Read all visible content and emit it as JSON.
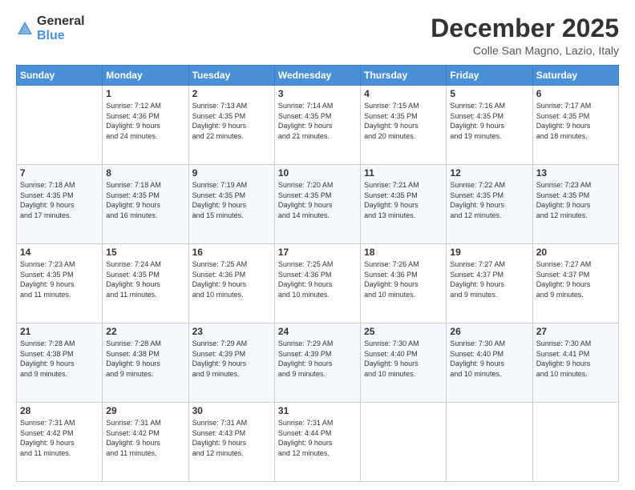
{
  "header": {
    "logo_general": "General",
    "logo_blue": "Blue",
    "month_title": "December 2025",
    "location": "Colle San Magno, Lazio, Italy"
  },
  "calendar": {
    "days_of_week": [
      "Sunday",
      "Monday",
      "Tuesday",
      "Wednesday",
      "Thursday",
      "Friday",
      "Saturday"
    ],
    "weeks": [
      [
        {
          "day": "",
          "info": ""
        },
        {
          "day": "1",
          "info": "Sunrise: 7:12 AM\nSunset: 4:36 PM\nDaylight: 9 hours\nand 24 minutes."
        },
        {
          "day": "2",
          "info": "Sunrise: 7:13 AM\nSunset: 4:35 PM\nDaylight: 9 hours\nand 22 minutes."
        },
        {
          "day": "3",
          "info": "Sunrise: 7:14 AM\nSunset: 4:35 PM\nDaylight: 9 hours\nand 21 minutes."
        },
        {
          "day": "4",
          "info": "Sunrise: 7:15 AM\nSunset: 4:35 PM\nDaylight: 9 hours\nand 20 minutes."
        },
        {
          "day": "5",
          "info": "Sunrise: 7:16 AM\nSunset: 4:35 PM\nDaylight: 9 hours\nand 19 minutes."
        },
        {
          "day": "6",
          "info": "Sunrise: 7:17 AM\nSunset: 4:35 PM\nDaylight: 9 hours\nand 18 minutes."
        }
      ],
      [
        {
          "day": "7",
          "info": "Sunrise: 7:18 AM\nSunset: 4:35 PM\nDaylight: 9 hours\nand 17 minutes."
        },
        {
          "day": "8",
          "info": "Sunrise: 7:18 AM\nSunset: 4:35 PM\nDaylight: 9 hours\nand 16 minutes."
        },
        {
          "day": "9",
          "info": "Sunrise: 7:19 AM\nSunset: 4:35 PM\nDaylight: 9 hours\nand 15 minutes."
        },
        {
          "day": "10",
          "info": "Sunrise: 7:20 AM\nSunset: 4:35 PM\nDaylight: 9 hours\nand 14 minutes."
        },
        {
          "day": "11",
          "info": "Sunrise: 7:21 AM\nSunset: 4:35 PM\nDaylight: 9 hours\nand 13 minutes."
        },
        {
          "day": "12",
          "info": "Sunrise: 7:22 AM\nSunset: 4:35 PM\nDaylight: 9 hours\nand 12 minutes."
        },
        {
          "day": "13",
          "info": "Sunrise: 7:23 AM\nSunset: 4:35 PM\nDaylight: 9 hours\nand 12 minutes."
        }
      ],
      [
        {
          "day": "14",
          "info": "Sunrise: 7:23 AM\nSunset: 4:35 PM\nDaylight: 9 hours\nand 11 minutes."
        },
        {
          "day": "15",
          "info": "Sunrise: 7:24 AM\nSunset: 4:35 PM\nDaylight: 9 hours\nand 11 minutes."
        },
        {
          "day": "16",
          "info": "Sunrise: 7:25 AM\nSunset: 4:36 PM\nDaylight: 9 hours\nand 10 minutes."
        },
        {
          "day": "17",
          "info": "Sunrise: 7:25 AM\nSunset: 4:36 PM\nDaylight: 9 hours\nand 10 minutes."
        },
        {
          "day": "18",
          "info": "Sunrise: 7:26 AM\nSunset: 4:36 PM\nDaylight: 9 hours\nand 10 minutes."
        },
        {
          "day": "19",
          "info": "Sunrise: 7:27 AM\nSunset: 4:37 PM\nDaylight: 9 hours\nand 9 minutes."
        },
        {
          "day": "20",
          "info": "Sunrise: 7:27 AM\nSunset: 4:37 PM\nDaylight: 9 hours\nand 9 minutes."
        }
      ],
      [
        {
          "day": "21",
          "info": "Sunrise: 7:28 AM\nSunset: 4:38 PM\nDaylight: 9 hours\nand 9 minutes."
        },
        {
          "day": "22",
          "info": "Sunrise: 7:28 AM\nSunset: 4:38 PM\nDaylight: 9 hours\nand 9 minutes."
        },
        {
          "day": "23",
          "info": "Sunrise: 7:29 AM\nSunset: 4:39 PM\nDaylight: 9 hours\nand 9 minutes."
        },
        {
          "day": "24",
          "info": "Sunrise: 7:29 AM\nSunset: 4:39 PM\nDaylight: 9 hours\nand 9 minutes."
        },
        {
          "day": "25",
          "info": "Sunrise: 7:30 AM\nSunset: 4:40 PM\nDaylight: 9 hours\nand 10 minutes."
        },
        {
          "day": "26",
          "info": "Sunrise: 7:30 AM\nSunset: 4:40 PM\nDaylight: 9 hours\nand 10 minutes."
        },
        {
          "day": "27",
          "info": "Sunrise: 7:30 AM\nSunset: 4:41 PM\nDaylight: 9 hours\nand 10 minutes."
        }
      ],
      [
        {
          "day": "28",
          "info": "Sunrise: 7:31 AM\nSunset: 4:42 PM\nDaylight: 9 hours\nand 11 minutes."
        },
        {
          "day": "29",
          "info": "Sunrise: 7:31 AM\nSunset: 4:42 PM\nDaylight: 9 hours\nand 11 minutes."
        },
        {
          "day": "30",
          "info": "Sunrise: 7:31 AM\nSunset: 4:43 PM\nDaylight: 9 hours\nand 12 minutes."
        },
        {
          "day": "31",
          "info": "Sunrise: 7:31 AM\nSunset: 4:44 PM\nDaylight: 9 hours\nand 12 minutes."
        },
        {
          "day": "",
          "info": ""
        },
        {
          "day": "",
          "info": ""
        },
        {
          "day": "",
          "info": ""
        }
      ]
    ]
  }
}
